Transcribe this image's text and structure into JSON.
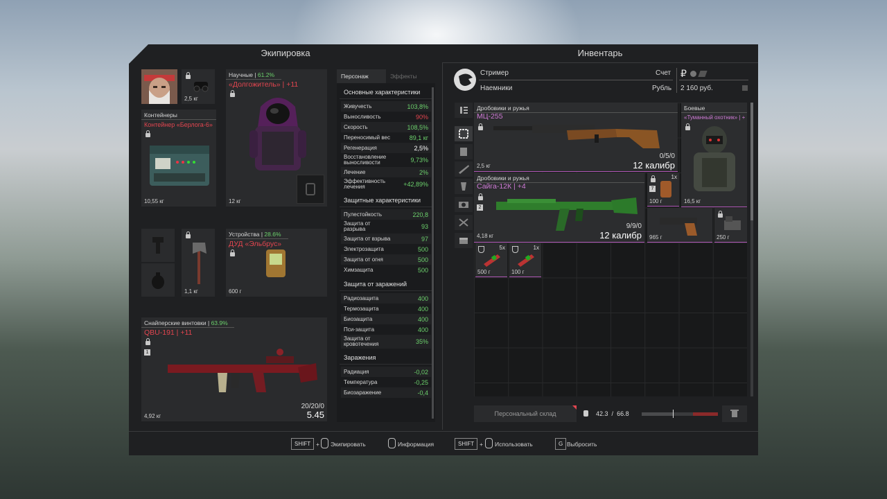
{
  "header": {
    "equipment_title": "Экипировка",
    "inventory_title": "Инвентарь"
  },
  "equipment": {
    "head_weight": "2,5 кг",
    "armor": {
      "category": "Научные | ",
      "category_pct": "61.2%",
      "name": "«Долгожитель» | +11",
      "weight": "12 кг"
    },
    "container": {
      "label": "Контейнеры",
      "name": "Контейнер «Берлога-6»",
      "weight": "10,55 кг"
    },
    "melee_weight": "1,1 кг",
    "device": {
      "category": "Устройства | ",
      "category_pct": "28.6%",
      "name": "ДУД «Эльбрус»",
      "weight": "600 г"
    },
    "rifle": {
      "category": "Снайперские винтовки | ",
      "category_pct": "63.9%",
      "name": "QBU-191 | +11",
      "badge": "1",
      "weight": "4,92 кг",
      "ammo": "20/20/0",
      "value": "5.45"
    }
  },
  "stats": {
    "tab_character": "Персонаж",
    "tab_effects": "Эффекты",
    "sections": [
      {
        "title": "Основные характеристики",
        "rows": [
          {
            "name": "Живучесть",
            "value": "103,8%",
            "color": "green"
          },
          {
            "name": "Выносливость",
            "value": "90%",
            "color": "red"
          },
          {
            "name": "Скорость",
            "value": "108,5%",
            "color": "green"
          },
          {
            "name": "Переносимый вес",
            "value": "89,1 кг",
            "color": "green"
          },
          {
            "name": "Регенерация",
            "value": "2,5%",
            "color": "white"
          },
          {
            "name": "Восстановление выносливости",
            "value": "9,73%",
            "color": "green"
          },
          {
            "name": "Лечение",
            "value": "2%",
            "color": "green"
          },
          {
            "name": "Эффективность лечения",
            "value": "+42,89%",
            "color": "green"
          }
        ]
      },
      {
        "title": "Защитные характеристики",
        "rows": [
          {
            "name": "Пулестойкость",
            "value": "220,8",
            "color": "green"
          },
          {
            "name": "Защита от разрыва",
            "value": "93",
            "color": "green"
          },
          {
            "name": "Защита от взрыва",
            "value": "97",
            "color": "green"
          },
          {
            "name": "Электрозащита",
            "value": "500",
            "color": "green"
          },
          {
            "name": "Защита от огня",
            "value": "500",
            "color": "green"
          },
          {
            "name": "Химзащита",
            "value": "500",
            "color": "green"
          }
        ]
      },
      {
        "title": "Защита от заражений",
        "rows": [
          {
            "name": "Радиозащита",
            "value": "400",
            "color": "green"
          },
          {
            "name": "Термозащита",
            "value": "400",
            "color": "green"
          },
          {
            "name": "Биозащита",
            "value": "400",
            "color": "green"
          },
          {
            "name": "Пси-защита",
            "value": "400",
            "color": "green"
          },
          {
            "name": "Защита от кровотечения",
            "value": "35%",
            "color": "green"
          }
        ]
      },
      {
        "title": "Заражения",
        "rows": [
          {
            "name": "Радиация",
            "value": "-0,02",
            "color": "green"
          },
          {
            "name": "Температура",
            "value": "-0,25",
            "color": "green"
          },
          {
            "name": "Биозаражение",
            "value": "-0,4",
            "color": "green"
          }
        ]
      }
    ]
  },
  "inventory": {
    "role": "Стример",
    "faction": "Наемники",
    "account_label": "Счет",
    "currency_label": "Рубль",
    "balance": "2 160 руб.",
    "currency_symbol": "₽",
    "items": {
      "shotgun1": {
        "category": "Дробовики и ружья",
        "name": "МЦ-255",
        "ammo": "0/5/0",
        "caliber": "12 калибр",
        "weight": "2,5 кг"
      },
      "armor": {
        "category": "Боевые",
        "name": "«Туманный охотник» | +...",
        "weight": "16,5 кг"
      },
      "shotgun2": {
        "category": "Дробовики и ружья",
        "name": "Сайга-12К | +4",
        "badge": "2",
        "ammo": "9/9/0",
        "caliber": "12 калибр",
        "weight": "4,18 кг"
      },
      "consumable": {
        "count": "1x",
        "badge": "7",
        "weight": "100 г"
      },
      "pistol": {
        "weight": "965 г"
      },
      "device": {
        "weight": "250 г"
      },
      "small1": {
        "count": "5x",
        "weight": "500 г"
      },
      "small2": {
        "count": "1x",
        "weight": "100 г"
      }
    },
    "storage_button": "Персональный склад",
    "weight_current": "42.3",
    "weight_separator": "/",
    "weight_max": "66.8"
  },
  "footer": {
    "shift1": "SHIFT",
    "equip": "Экипировать",
    "info": "Информация",
    "shift2": "SHIFT",
    "use": "Использовать",
    "key_g": "G",
    "drop": "Выбросить",
    "plus1": "+",
    "plus2": "+"
  },
  "colors": {
    "accent_red": "#e2454f",
    "accent_green": "#6cd16c",
    "rarity_pink": "#d07bd7",
    "panel": "#1f2022"
  }
}
